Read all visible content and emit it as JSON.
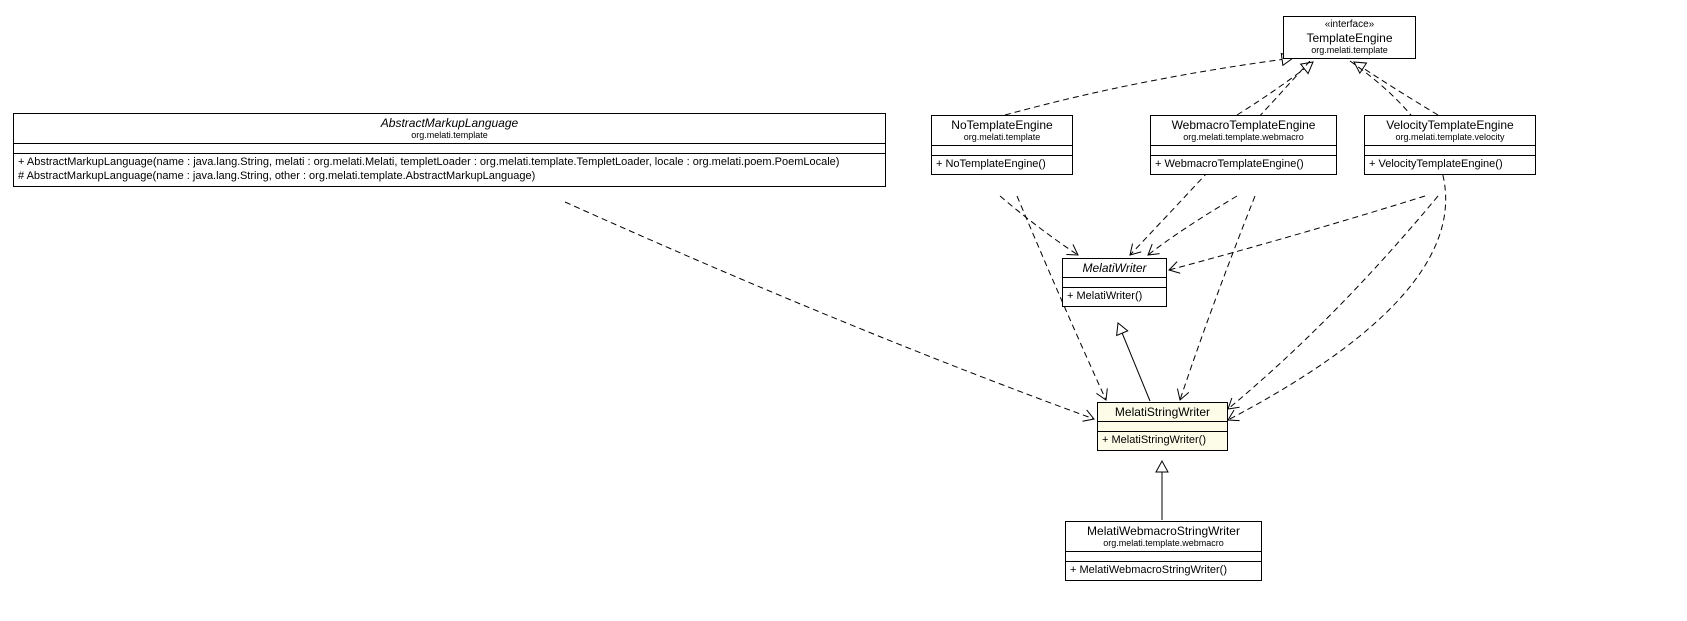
{
  "classes": {
    "templateEngine": {
      "stereotype": "«interface»",
      "name": "TemplateEngine",
      "package": "org.melati.template"
    },
    "abstractMarkupLanguage": {
      "name": "AbstractMarkupLanguage",
      "package": "org.melati.template",
      "ops": [
        "+ AbstractMarkupLanguage(name : java.lang.String, melati : org.melati.Melati, templetLoader : org.melati.template.TempletLoader, locale : org.melati.poem.PoemLocale)",
        "# AbstractMarkupLanguage(name : java.lang.String, other : org.melati.template.AbstractMarkupLanguage)"
      ]
    },
    "noTemplateEngine": {
      "name": "NoTemplateEngine",
      "package": "org.melati.template",
      "op": "+ NoTemplateEngine()"
    },
    "webmacroTemplateEngine": {
      "name": "WebmacroTemplateEngine",
      "package": "org.melati.template.webmacro",
      "op": "+ WebmacroTemplateEngine()"
    },
    "velocityTemplateEngine": {
      "name": "VelocityTemplateEngine",
      "package": "org.melati.template.velocity",
      "op": "+ VelocityTemplateEngine()"
    },
    "melatiWriter": {
      "name": "MelatiWriter",
      "op": "+ MelatiWriter()"
    },
    "melatiStringWriter": {
      "name": "MelatiStringWriter",
      "op": "+ MelatiStringWriter()"
    },
    "melatiWebmacroStringWriter": {
      "name": "MelatiWebmacroStringWriter",
      "package": "org.melati.template.webmacro",
      "op": "+ MelatiWebmacroStringWriter()"
    }
  }
}
